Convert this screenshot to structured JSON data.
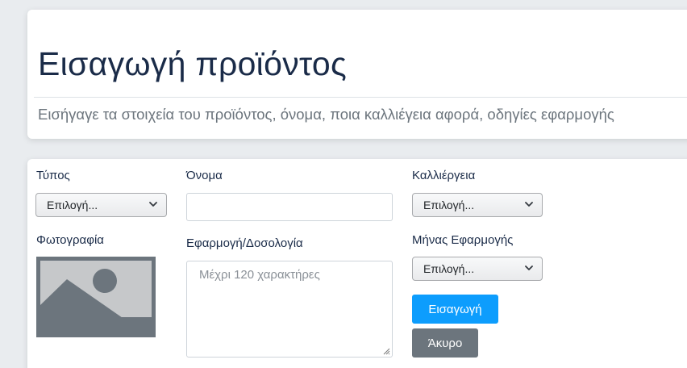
{
  "header": {
    "title": "Εισαγωγή προϊόντος",
    "subtitle": "Εισήγαγε τα στοιχεία του προϊόντος, όνομα, ποια καλλιέγεια αφορά, οδηγίες εφαρμογής"
  },
  "form": {
    "type_label": "Τύπος",
    "type_select_value": "Επιλογή...",
    "photo_label": "Φωτογραφία",
    "name_label": "Όνομα",
    "name_value": "",
    "dosage_label": "Εφαρμογή/Δοσολογία",
    "dosage_placeholder": "Μέχρι 120 χαρακτήρες",
    "crop_label": "Καλλιέργεια",
    "crop_select_value": "Επιλογή...",
    "month_label": "Μήνας Εφαρμογής",
    "month_select_value": "Επιλογή...",
    "submit_label": "Εισαγωγή",
    "cancel_label": "Άκυρο"
  },
  "icons": {
    "select_arrow": "chevron-down-icon",
    "photo_placeholder": "image-placeholder-icon",
    "textarea_resize": "resize-grip-icon"
  },
  "colors": {
    "primary": "#0d9dfd",
    "secondary": "#6c757d",
    "title": "#1a2b48",
    "subtitle": "#6c757d"
  }
}
